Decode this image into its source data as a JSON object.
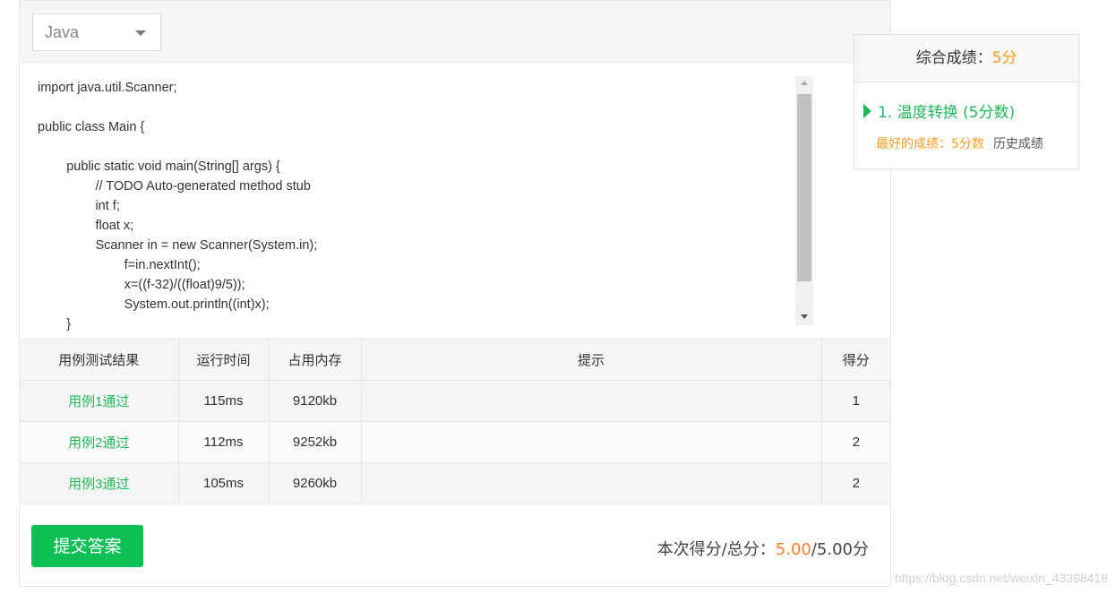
{
  "editor": {
    "language": "Java",
    "code_lines": [
      "import java.util.Scanner;",
      "",
      "public class Main {",
      "",
      "        public static void main(String[] args) {",
      "                // TODO Auto-generated method stub",
      "                int f;",
      "                float x;",
      "                Scanner in = new Scanner(System.in);",
      "                        f=in.nextInt();",
      "                        x=((f-32)/((float)9/5));",
      "                        System.out.println((int)x);",
      "        }"
    ]
  },
  "results": {
    "headers": [
      "用例测试结果",
      "运行时间",
      "占用内存",
      "提示",
      "得分"
    ],
    "rows": [
      {
        "result": "用例1通过",
        "time": "115ms",
        "memory": "9120kb",
        "hint": "",
        "score": "1"
      },
      {
        "result": "用例2通过",
        "time": "112ms",
        "memory": "9252kb",
        "hint": "",
        "score": "2"
      },
      {
        "result": "用例3通过",
        "time": "105ms",
        "memory": "9260kb",
        "hint": "",
        "score": "2"
      }
    ]
  },
  "footer": {
    "submit_label": "提交答案",
    "score_label": "本次得分/总分：",
    "score_got": "5.00",
    "score_total": "/5.00分"
  },
  "side": {
    "total_label": "综合成绩：",
    "total_value": "5分",
    "problem_title": "1. 温度转换 (5分数)",
    "best_label": "最好的成绩：5分数",
    "history_label": "历史成绩"
  },
  "watermark": "https://blog.csdn.net/weixin_43398418",
  "colors": {
    "pass_green": "#1fb95a",
    "submit_green": "#0cc055",
    "score_orange": "#ff7f26",
    "best_orange": "#ff9c1f"
  }
}
